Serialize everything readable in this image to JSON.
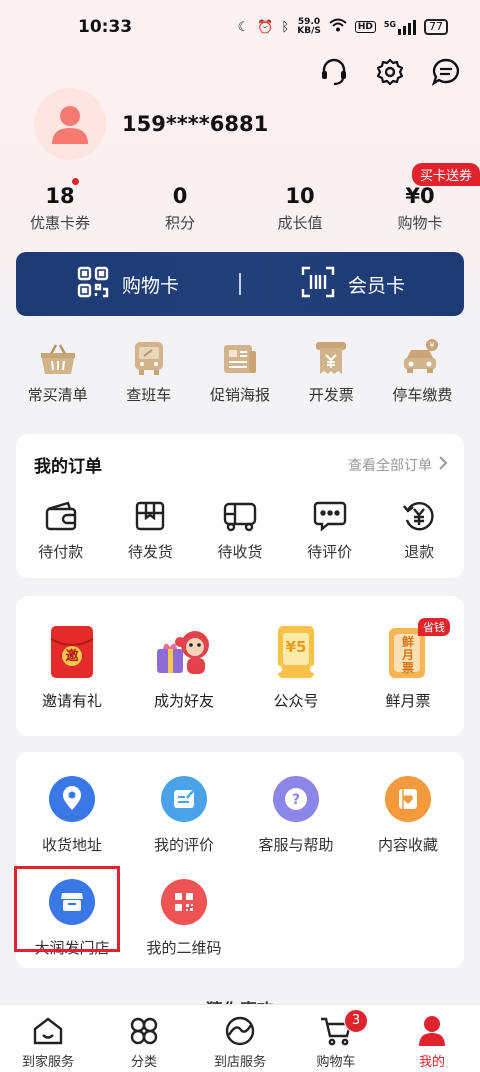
{
  "status_bar": {
    "time": "10:33",
    "net_speed_value": "59.0",
    "net_speed_unit": "KB/S",
    "battery": "77",
    "signal": "5G"
  },
  "header": {
    "icons": [
      "headset-icon",
      "gear-icon",
      "message-icon"
    ]
  },
  "profile": {
    "phone": "159****6881"
  },
  "stats": [
    {
      "value": "18",
      "label": "优惠卡券"
    },
    {
      "value": "0",
      "label": "积分"
    },
    {
      "value": "10",
      "label": "成长值"
    },
    {
      "value": "¥0",
      "label": "购物卡"
    }
  ],
  "buy_card_badge": "买卡送券",
  "card_bar": {
    "shopping_card": "购物卡",
    "member_card": "会员卡",
    "separator": "|"
  },
  "quick_links": [
    {
      "label": "常买清单",
      "icon": "basket-icon"
    },
    {
      "label": "查班车",
      "icon": "bus-icon"
    },
    {
      "label": "促销海报",
      "icon": "poster-icon"
    },
    {
      "label": "开发票",
      "icon": "invoice-icon"
    },
    {
      "label": "停车缴费",
      "icon": "parking-icon"
    }
  ],
  "orders": {
    "title": "我的订单",
    "view_all": "查看全部订单",
    "items": [
      {
        "label": "待付款",
        "icon": "wallet-icon"
      },
      {
        "label": "待发货",
        "icon": "box-icon"
      },
      {
        "label": "待收货",
        "icon": "truck-icon"
      },
      {
        "label": "待评价",
        "icon": "comment-icon"
      },
      {
        "label": "退款",
        "icon": "refund-icon"
      }
    ]
  },
  "promos": [
    {
      "label": "邀请有礼",
      "icon": "red-envelope-icon",
      "glyph": "邀"
    },
    {
      "label": "成为好友",
      "icon": "gift-monkey-icon"
    },
    {
      "label": "公众号",
      "icon": "ticket-icon",
      "glyph": "¥5"
    },
    {
      "label": "鲜月票",
      "icon": "monthly-pass-icon",
      "glyph": "鲜月票",
      "badge": "省钱"
    }
  ],
  "services": [
    {
      "label": "收货地址",
      "icon": "location-icon",
      "color": "#3b78e7"
    },
    {
      "label": "我的评价",
      "icon": "edit-icon",
      "color": "#4aa3e8"
    },
    {
      "label": "客服与帮助",
      "icon": "help-icon",
      "color": "#8b86e8"
    },
    {
      "label": "内容收藏",
      "icon": "favorite-icon",
      "color": "#f29a3c"
    },
    {
      "label": "大润发门店",
      "icon": "store-icon",
      "color": "#3b78e7"
    },
    {
      "label": "我的二维码",
      "icon": "qrcode-icon",
      "color": "#f05353"
    }
  ],
  "guess_title": "— 猜你喜欢 —",
  "tabbar": [
    {
      "label": "到家服务",
      "icon": "home-icon"
    },
    {
      "label": "分类",
      "icon": "category-icon"
    },
    {
      "label": "到店服务",
      "icon": "store-visit-icon"
    },
    {
      "label": "购物车",
      "icon": "cart-icon",
      "badge": "3"
    },
    {
      "label": "我的",
      "icon": "profile-icon",
      "active": true
    }
  ],
  "colors": {
    "brand_red": "#e0232c",
    "card_navy": "#1d3a73"
  }
}
